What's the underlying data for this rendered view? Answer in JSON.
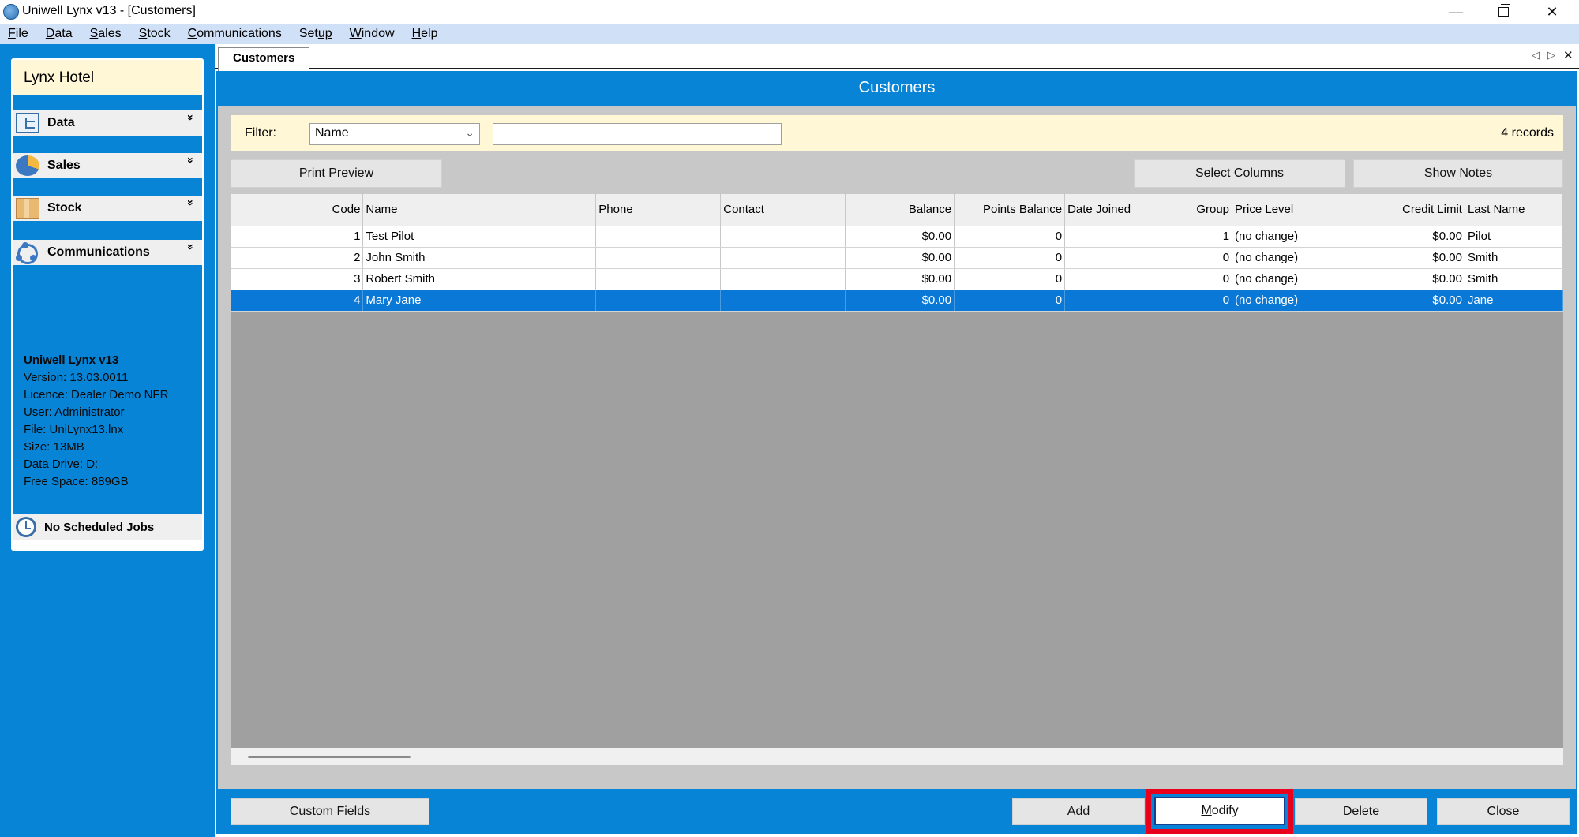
{
  "window": {
    "title": "Uniwell Lynx v13 - [Customers]",
    "minimize": "—",
    "close": "✕"
  },
  "menu": {
    "items": [
      {
        "first": "F",
        "rest": "ile"
      },
      {
        "first": "D",
        "rest": "ata"
      },
      {
        "first": "S",
        "rest": "ales"
      },
      {
        "first": "S",
        "rest": "tock"
      },
      {
        "first": "C",
        "rest": "ommunications"
      },
      {
        "first": "Set",
        "rest": "up",
        "underline_index": 3
      },
      {
        "first": "W",
        "rest": "indow"
      },
      {
        "first": "H",
        "rest": "elp"
      }
    ]
  },
  "sidebar": {
    "header": "Lynx Hotel",
    "sections": [
      {
        "label": "Data",
        "icon": "data-icon"
      },
      {
        "label": "Sales",
        "icon": "sales-icon"
      },
      {
        "label": "Stock",
        "icon": "stock-icon"
      },
      {
        "label": "Communications",
        "icon": "communications-icon"
      }
    ],
    "chevron": "»",
    "info": {
      "product": "Uniwell Lynx v13",
      "version": "Version: 13.03.0011",
      "licence": "Licence: Dealer Demo NFR",
      "user": "User: Administrator",
      "file": "File: UniLynx13.lnx",
      "size": "Size: 13MB",
      "drive": "Data Drive: D:",
      "free": "Free Space: 889GB"
    },
    "jobs": "No Scheduled Jobs"
  },
  "tabs": {
    "active": "Customers",
    "prev": "◁",
    "next": "▷",
    "close": "✕"
  },
  "main": {
    "title": "Customers",
    "filter": {
      "label": "Filter:",
      "field": "Name",
      "value": "",
      "records": "4 records"
    },
    "buttons": {
      "print_preview": "Print Preview",
      "select_columns": "Select Columns",
      "show_notes": "Show Notes"
    },
    "table": {
      "columns": [
        "Code",
        "Name",
        "Phone",
        "Contact",
        "Balance",
        "Points Balance",
        "Date Joined",
        "Group",
        "Price Level",
        "Credit Limit",
        "Last Name"
      ],
      "rows": [
        [
          "1",
          "Test Pilot",
          "",
          "",
          "$0.00",
          "0",
          "",
          "1",
          "(no change)",
          "$0.00",
          "Pilot"
        ],
        [
          "2",
          "John Smith",
          "",
          "",
          "$0.00",
          "0",
          "",
          "0",
          "(no change)",
          "$0.00",
          "Smith"
        ],
        [
          "3",
          "Robert Smith",
          "",
          "",
          "$0.00",
          "0",
          "",
          "0",
          "(no change)",
          "$0.00",
          "Smith"
        ],
        [
          "4",
          "Mary Jane",
          "",
          "",
          "$0.00",
          "0",
          "",
          "0",
          "(no change)",
          "$0.00",
          "Jane"
        ]
      ],
      "selected_row": 3
    }
  },
  "bottom": {
    "custom_fields": "Custom Fields",
    "add": {
      "first": "A",
      "rest": "dd"
    },
    "modify": {
      "first": "M",
      "rest": "odify"
    },
    "delete": {
      "pre": "D",
      "u": "e",
      "rest": "lete"
    },
    "close": {
      "pre": "Cl",
      "u": "o",
      "rest": "se"
    }
  },
  "colors": {
    "accent": "#0784d6",
    "selection": "#0a78d7",
    "filter_bg": "#fff7d6",
    "highlight": "#e8001c"
  }
}
